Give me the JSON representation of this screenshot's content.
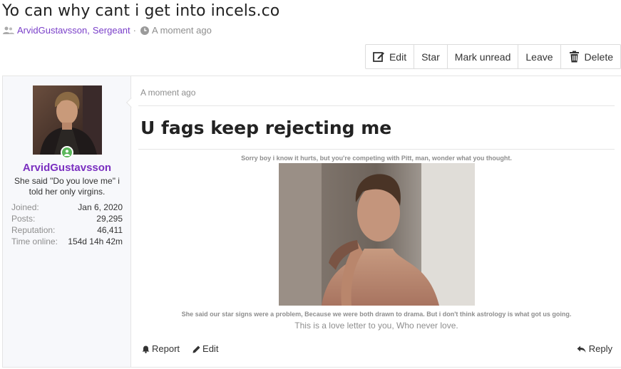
{
  "thread": {
    "title": "Yo can why cant i get into incels.co",
    "author": "ArvidGustavsson",
    "rank": "Sergeant",
    "separator": ",",
    "dot": "·",
    "time": "A moment ago"
  },
  "toolbar": {
    "edit_label": "Edit",
    "star_label": "Star",
    "mark_unread_label": "Mark unread",
    "leave_label": "Leave",
    "delete_label": "Delete"
  },
  "sidebar": {
    "username": "ArvidGustavsson",
    "signature": "She said \"Do you love me\" i told her only virgins.",
    "stats": [
      {
        "label": "Joined:",
        "value": "Jan 6, 2020"
      },
      {
        "label": "Posts:",
        "value": "29,295"
      },
      {
        "label": "Reputation:",
        "value": "46,411"
      },
      {
        "label": "Time online:",
        "value": "154d 14h 42m"
      }
    ],
    "online_color": "#5cb85c",
    "username_color": "#7a2fc0"
  },
  "post": {
    "time": "A moment ago",
    "heading": "U fags keep rejecting me",
    "caption_top": "Sorry boy i know it hurts, but you're competing with Pitt, man, wonder what you thought.",
    "caption_bottom": "She said our star signs were a problem, Because we were both drawn to drama. But i don't think astrology is what got us going.",
    "caption_love": "This is a love letter to you, Who never love.",
    "actions": {
      "report_label": "Report",
      "edit_label": "Edit",
      "reply_label": "Reply"
    }
  },
  "icons": {
    "users": "users-icon",
    "clock": "clock-icon",
    "edit": "edit-icon",
    "delete": "trash-icon",
    "report": "bell-icon",
    "pencil": "pencil-icon",
    "reply": "reply-icon"
  },
  "colors": {
    "link": "#7a3fc9",
    "muted": "#8e8e8e"
  }
}
